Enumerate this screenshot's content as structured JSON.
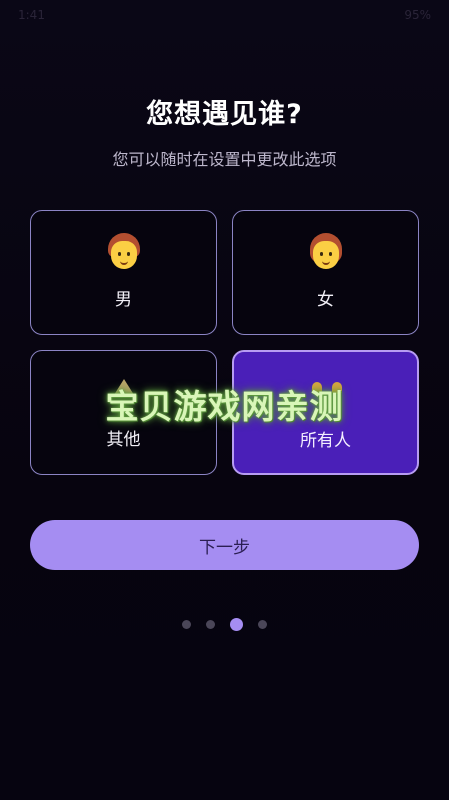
{
  "status_bar": {
    "time": "1:41",
    "right": "95%"
  },
  "header": {
    "title": "您想遇见谁?",
    "subtitle": "您可以随时在设置中更改此选项"
  },
  "options": [
    {
      "label": "男",
      "icon": "man-face-icon",
      "selected": false
    },
    {
      "label": "女",
      "icon": "woman-face-icon",
      "selected": false
    },
    {
      "label": "其他",
      "icon": "other-icon",
      "selected": false
    },
    {
      "label": "所有人",
      "icon": "people-icon",
      "selected": true
    }
  ],
  "watermark": "宝贝游戏网亲测",
  "next_button": {
    "label": "下一步"
  },
  "pagination": {
    "total": 4,
    "current": 3
  },
  "colors": {
    "background": "#07040f",
    "accent": "#a58df2",
    "selected_card": "#4a1fb8",
    "card_border": "#8b84c4"
  }
}
